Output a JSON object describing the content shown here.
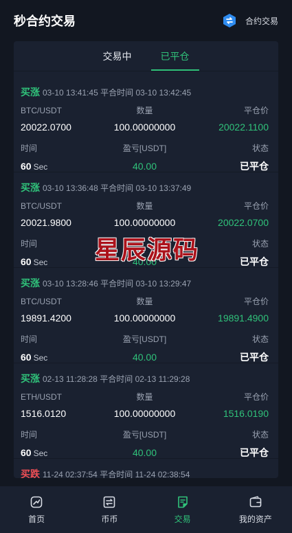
{
  "header": {
    "title": "秒合约交易",
    "link": "合约交易"
  },
  "tabs": [
    {
      "label": "交易中",
      "active": false
    },
    {
      "label": "已平仓",
      "active": true
    }
  ],
  "orders": [
    {
      "side": "买涨",
      "side_type": "up",
      "open_time": "03-10 13:41:45",
      "close_label": "平合时间",
      "close_time": "03-10 13:42:45",
      "pair_label": "BTC/USDT",
      "qty_label": "数量",
      "close_price_label": "平仓价",
      "open_price": "20022.0700",
      "qty": "100.00000000",
      "close_price": "20022.1100",
      "time_label": "时间",
      "pnl_label": "盈亏[USDT]",
      "status_label": "状态",
      "duration": "60",
      "duration_unit": "Sec",
      "pnl": "40.00",
      "status": "已平仓"
    },
    {
      "side": "买涨",
      "side_type": "up",
      "open_time": "03-10 13:36:48",
      "close_label": "平合时间",
      "close_time": "03-10 13:37:49",
      "pair_label": "BTC/USDT",
      "qty_label": "数量",
      "close_price_label": "平仓价",
      "open_price": "20021.9800",
      "qty": "100.00000000",
      "close_price": "20022.0700",
      "time_label": "时间",
      "pnl_label": "",
      "status_label": "状态",
      "duration": "60",
      "duration_unit": "Sec",
      "pnl": "40.00",
      "status": "已平仓"
    },
    {
      "side": "买涨",
      "side_type": "up",
      "open_time": "03-10 13:28:46",
      "close_label": "平合时间",
      "close_time": "03-10 13:29:47",
      "pair_label": "BTC/USDT",
      "qty_label": "数量",
      "close_price_label": "平仓价",
      "open_price": "19891.4200",
      "qty": "100.00000000",
      "close_price": "19891.4900",
      "time_label": "时间",
      "pnl_label": "盈亏[USDT]",
      "status_label": "状态",
      "duration": "60",
      "duration_unit": "Sec",
      "pnl": "40.00",
      "status": "已平仓"
    },
    {
      "side": "买涨",
      "side_type": "up",
      "open_time": "02-13 11:28:28",
      "close_label": "平合时间",
      "close_time": "02-13 11:29:28",
      "pair_label": "ETH/USDT",
      "qty_label": "数量",
      "close_price_label": "平仓价",
      "open_price": "1516.0120",
      "qty": "100.00000000",
      "close_price": "1516.0190",
      "time_label": "时间",
      "pnl_label": "盈亏[USDT]",
      "status_label": "状态",
      "duration": "60",
      "duration_unit": "Sec",
      "pnl": "40.00",
      "status": "已平仓"
    },
    {
      "side": "买跌",
      "side_type": "down",
      "open_time": "11-24 02:37:54",
      "close_label": "平合时间",
      "close_time": "11-24 02:38:54"
    }
  ],
  "watermark": "星辰源码",
  "bottom_nav": [
    {
      "label": "首页",
      "icon": "home-icon"
    },
    {
      "label": "币币",
      "icon": "exchange-icon"
    },
    {
      "label": "交易",
      "icon": "trade-icon",
      "active": true
    },
    {
      "label": "我的资产",
      "icon": "wallet-icon"
    }
  ],
  "colors": {
    "background": "#121721",
    "panel": "#1a2130",
    "green": "#30c27a",
    "red": "#f04f55"
  }
}
